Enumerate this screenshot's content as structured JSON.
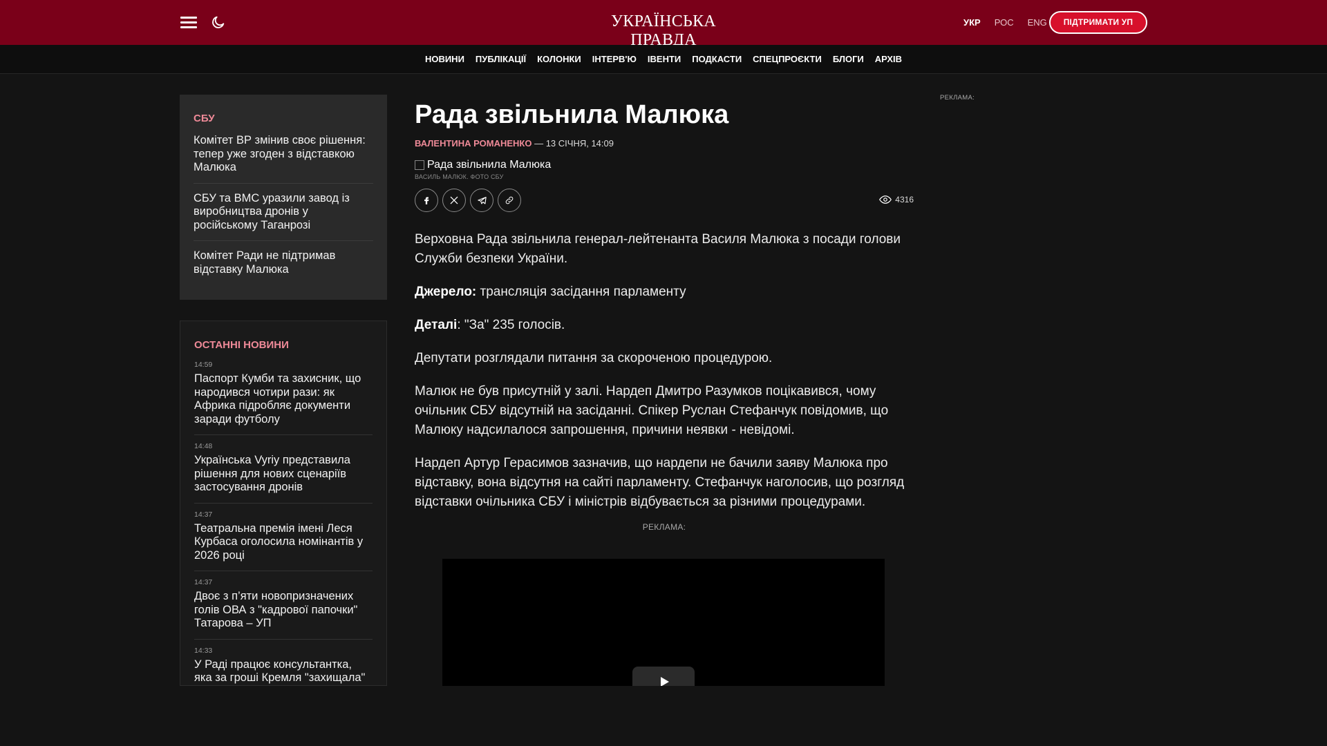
{
  "header": {
    "logo": "УКРАЇНСЬКА ПРАВДА",
    "langs": [
      "УКР",
      "РОС",
      "ENG"
    ],
    "support_label": "ПІДТРИМАТИ УП",
    "colors": {
      "bar": "#7a0019",
      "accent": "#d7102b"
    },
    "icons": [
      "hamburger-menu-icon",
      "moon-icon"
    ]
  },
  "nav": [
    "НОВИНИ",
    "ПУБЛІКАЦІЇ",
    "КОЛОНКИ",
    "ІНТЕРВ'Ю",
    "ІВЕНТИ",
    "ПОДКАСТИ",
    "СПЕЦПРОЄКТИ",
    "БЛОГИ",
    "АРХІВ"
  ],
  "sbu_card": {
    "tag": "СБУ",
    "items": [
      "Комітет ВР змінив своє рішення: тепер уже згоден з відставкою Малюка",
      "СБУ та ВМС уразили завод із виробництва дронів у російському Таганрозі",
      "Комітет Ради не підтримав відставку Малюка"
    ]
  },
  "latest": {
    "heading": "ОСТАННІ НОВИНИ",
    "items": [
      {
        "time": "14:59",
        "title": "Паспорт Кумби та захисник, що народився чотири рази: як Африка підробляє документи заради футболу"
      },
      {
        "time": "14:48",
        "title": "Українська Vyriy представила рішення для нових сценаріїв застосування дронів"
      },
      {
        "time": "14:37",
        "title": "Театральна премія імені Леся Курбаса оголосила номінантів у 2026 році"
      },
      {
        "time": "14:37",
        "title": "Двоє з п’яти новопризначених голів ОВА з \"кадрової папочки\" Татарова – УП"
      },
      {
        "time": "14:33",
        "title": "У Раді працює консультантка, яка за гроші Кремля \"захищала\" російськомовних в"
      }
    ]
  },
  "article": {
    "title": "Рада звільнила Малюка",
    "author": "ВАЛЕНТИНА РОМАНЕНКО",
    "date": "— 13 СІЧНЯ, 14:09",
    "photo_alt": "Рада звільнила Малюка",
    "photo_caption": "ВАСИЛЬ МАЛЮК. ФОТО СБУ",
    "share_icons": [
      "facebook-icon",
      "x-icon",
      "telegram-icon",
      "link-icon"
    ],
    "views": "4316",
    "lead": "Верховна Рада звільнила генерал-лейтенанта Василя Малюка з посади голови Служби безпеки України.",
    "source_label": "Джерело:",
    "source_text": " трансляція засідання парламенту",
    "details_label": "Деталі",
    "details_text": ": \"За\" 235 голосів.",
    "p1": "Депутати розглядали питання за скороченою процедурою.",
    "p2": "Малюк не був присутній у залі. Нардеп Дмитро Разумков поцікавився, чому очільник СБУ відсутній на засіданні. Спікер Руслан Стефанчук повідомив, що Малюку надсилалося запрошення, причини неявки - невідомі.",
    "p3": "Нардеп Артур Герасимов зазначив, що нардепи не бачили заяву Малюка про відставку, вона відсутня на сайті парламенту. Стефанчук наголосив, що розгляд відставки очільника СБУ і міністрів відбувається за різними процедурами.",
    "ad_label": "РЕКЛАМА:"
  },
  "right_ad_label": "РЕКЛАМА:"
}
